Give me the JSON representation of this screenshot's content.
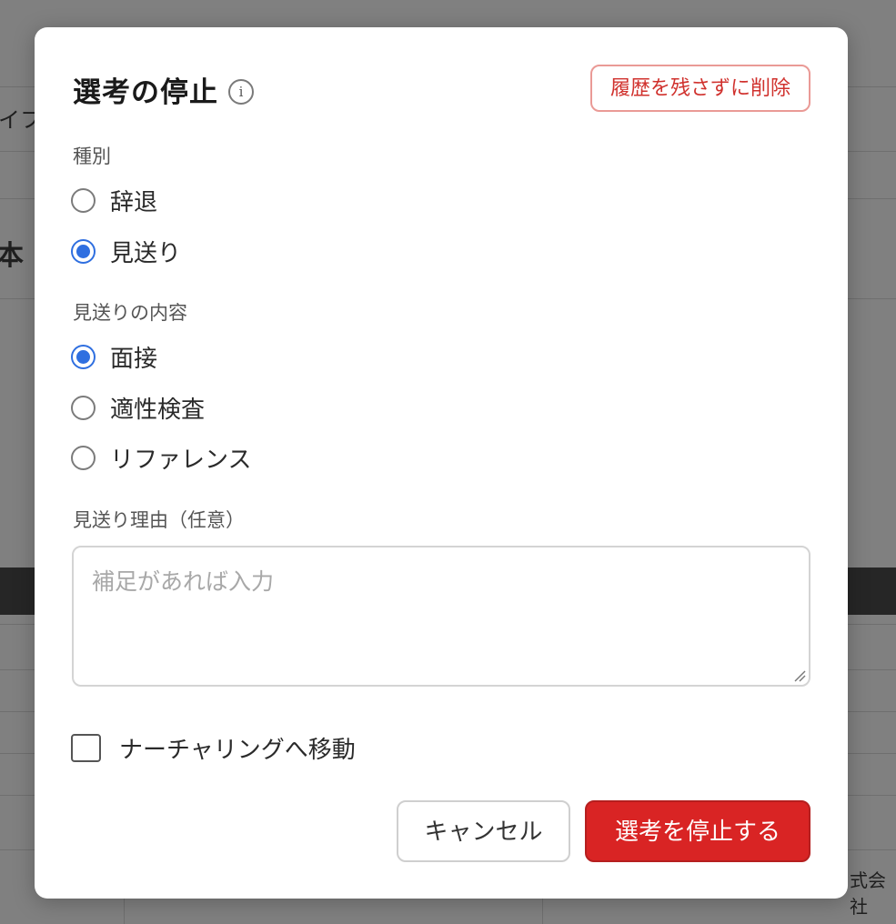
{
  "background": {
    "fragment_left_1": "イフ",
    "fragment_left_2": "本",
    "fragment_bottom_right": "式会社"
  },
  "modal": {
    "title": "選考の停止",
    "info_icon_glyph": "i",
    "delete_history_label": "履歴を残さずに削除",
    "type_section": {
      "label": "種別",
      "options": [
        {
          "label": "辞退",
          "selected": false
        },
        {
          "label": "見送り",
          "selected": true
        }
      ]
    },
    "content_section": {
      "label": "見送りの内容",
      "options": [
        {
          "label": "面接",
          "selected": true
        },
        {
          "label": "適性検査",
          "selected": false
        },
        {
          "label": "リファレンス",
          "selected": false
        }
      ]
    },
    "reason": {
      "label": "見送り理由（任意）",
      "placeholder": "補足があれば入力",
      "value": ""
    },
    "nurturing_checkbox": {
      "label": "ナーチャリングへ移動",
      "checked": false
    },
    "cancel_label": "キャンセル",
    "submit_label": "選考を停止する"
  },
  "colors": {
    "accent": "#2f6fe0",
    "danger": "#d92424",
    "danger_text": "#d0312d"
  },
  "icons": {
    "info": "info-icon",
    "resize": "resize-handle-icon"
  }
}
